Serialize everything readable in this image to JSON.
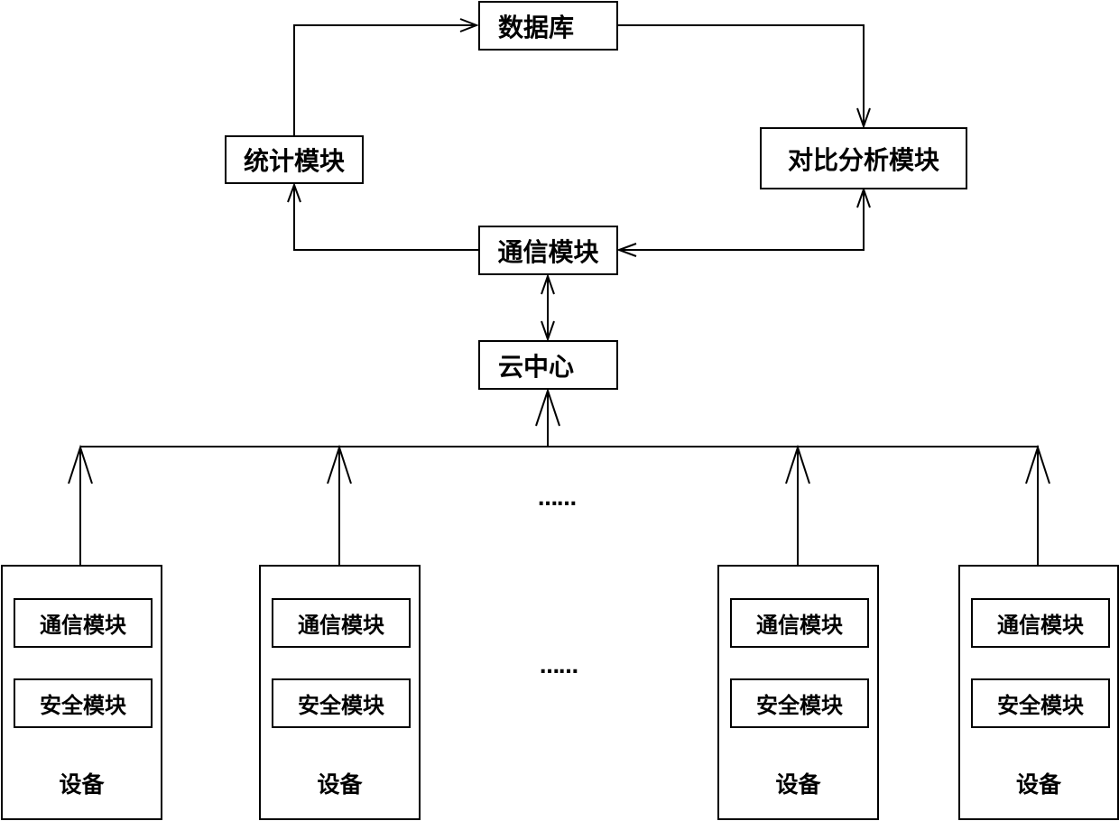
{
  "diagram": {
    "nodes": {
      "database": "数据库",
      "statistics_module": "统计模块",
      "comparison_analysis_module": "对比分析模块",
      "communication_module": "通信模块",
      "cloud_center": "云中心"
    },
    "devices": [
      {
        "label": "设备",
        "communication_module": "通信模块",
        "security_module": "安全模块"
      },
      {
        "label": "设备",
        "communication_module": "通信模块",
        "security_module": "安全模块"
      },
      {
        "label": "设备",
        "communication_module": "通信模块",
        "security_module": "安全模块"
      },
      {
        "label": "设备",
        "communication_module": "通信模块",
        "security_module": "安全模块"
      }
    ],
    "ellipsis_top": "……",
    "ellipsis_bottom": "……",
    "edges": [
      {
        "from": "statistics_module",
        "to": "database",
        "type": "arrow"
      },
      {
        "from": "database",
        "to": "comparison_analysis_module",
        "type": "arrow"
      },
      {
        "from": "communication_module",
        "to": "statistics_module",
        "type": "arrow"
      },
      {
        "from": "communication_module",
        "to": "comparison_analysis_module",
        "type": "bidirectional"
      },
      {
        "from": "communication_module",
        "to": "cloud_center",
        "type": "bidirectional"
      },
      {
        "from": "devices",
        "to": "cloud_center",
        "type": "arrow"
      }
    ]
  }
}
